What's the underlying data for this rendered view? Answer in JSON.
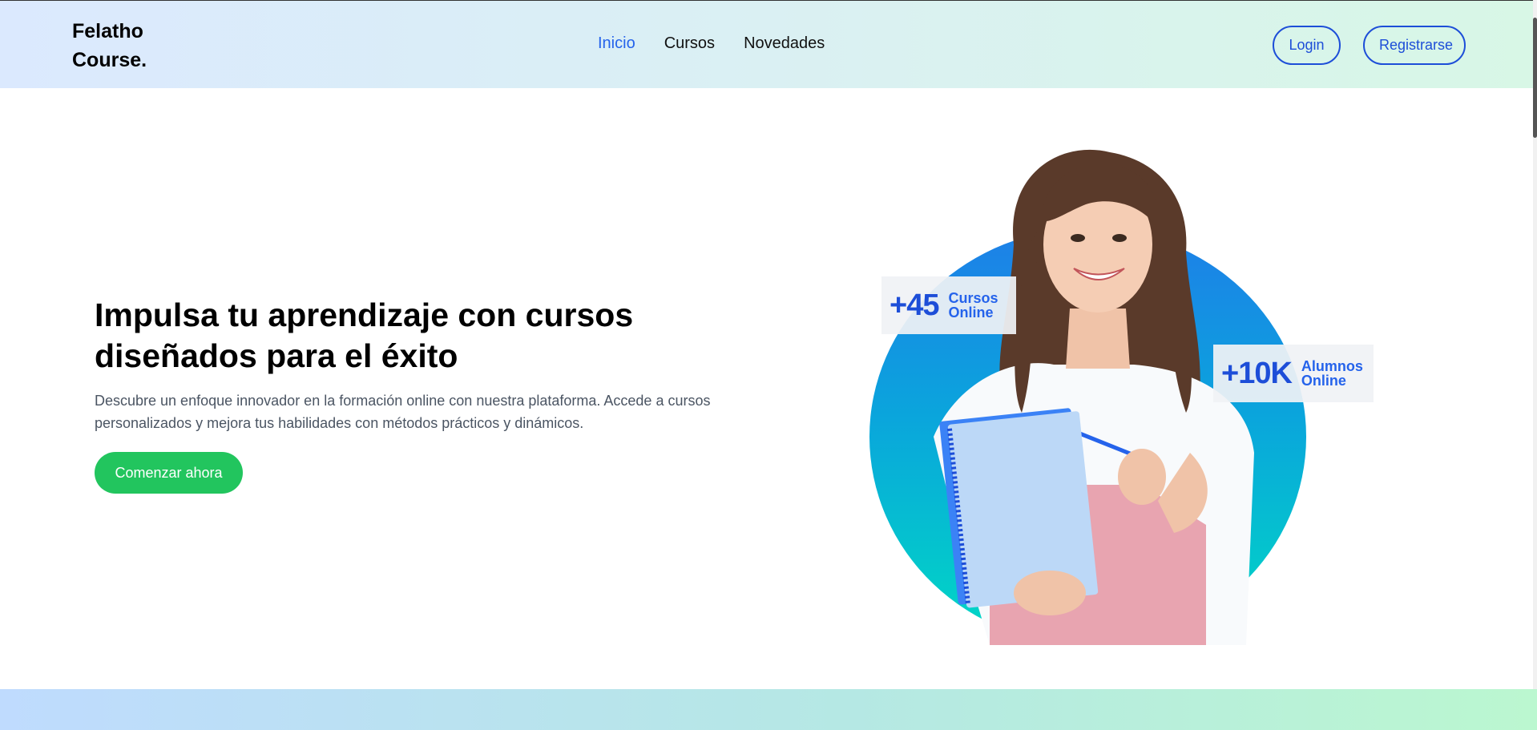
{
  "header": {
    "logo_line1": "Felatho",
    "logo_line2": "Course.",
    "nav": [
      {
        "label": "Inicio",
        "active": true
      },
      {
        "label": "Cursos",
        "active": false
      },
      {
        "label": "Novedades",
        "active": false
      }
    ],
    "login_label": "Login",
    "register_label": "Registrarse"
  },
  "hero": {
    "title": "Impulsa tu aprendizaje con cursos diseñados para el éxito",
    "description": "Descubre un enfoque innovador en la formación online con nuestra plataforma. Accede a cursos personalizados y mejora tus habilidades con métodos prácticos y dinámicos.",
    "cta_label": "Comenzar ahora"
  },
  "stats": {
    "courses": {
      "number": "+45",
      "label_line1": "Cursos",
      "label_line2": "Online"
    },
    "students": {
      "number": "+10K",
      "label_line1": "Alumnos",
      "label_line2": "Online"
    }
  },
  "colors": {
    "accent": "#2563eb",
    "cta": "#22c55e",
    "circle_top": "#1e7fe8",
    "circle_bottom": "#00d9c4"
  },
  "icons": {
    "hero_image": "student-with-notebook-illustration"
  }
}
